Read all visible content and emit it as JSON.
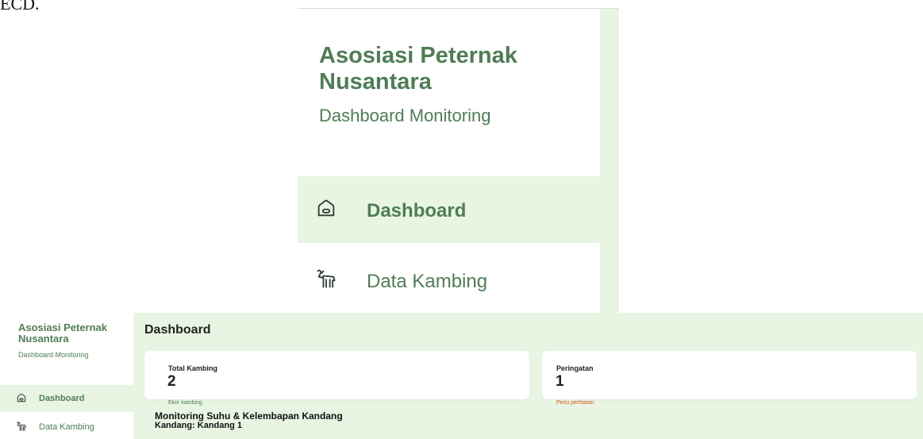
{
  "corner_text": "ECD.",
  "zoom": {
    "title": "Asosiasi Peternak Nusantara",
    "subtitle": "Dashboard Monitoring",
    "nav": [
      {
        "label": "Dashboard",
        "icon": "home-icon",
        "active": true
      },
      {
        "label": "Data Kambing",
        "icon": "goat-icon",
        "active": false
      }
    ]
  },
  "sidebar": {
    "title": "Asosiasi Peternak Nusantara",
    "subtitle": "Dashboard Monitoring",
    "items": [
      {
        "label": "Dashboard",
        "icon": "home-icon",
        "active": true
      },
      {
        "label": "Data Kambing",
        "icon": "goat-icon",
        "active": false
      }
    ]
  },
  "main": {
    "title": "Dashboard",
    "cards": [
      {
        "label": "Total Kambing",
        "value": "2",
        "note": "Ekor kambing"
      },
      {
        "label": "Peringatan",
        "value": "1",
        "note": "Perlu perhatian"
      }
    ],
    "section_title": "Monitoring Suhu & Kelembapan Kandang",
    "section_sub": "Kandang: Kandang 1"
  },
  "colors": {
    "brand_green": "#4f7d55",
    "light_green_bg": "#e8f5e3",
    "warning": "#d9531e"
  }
}
